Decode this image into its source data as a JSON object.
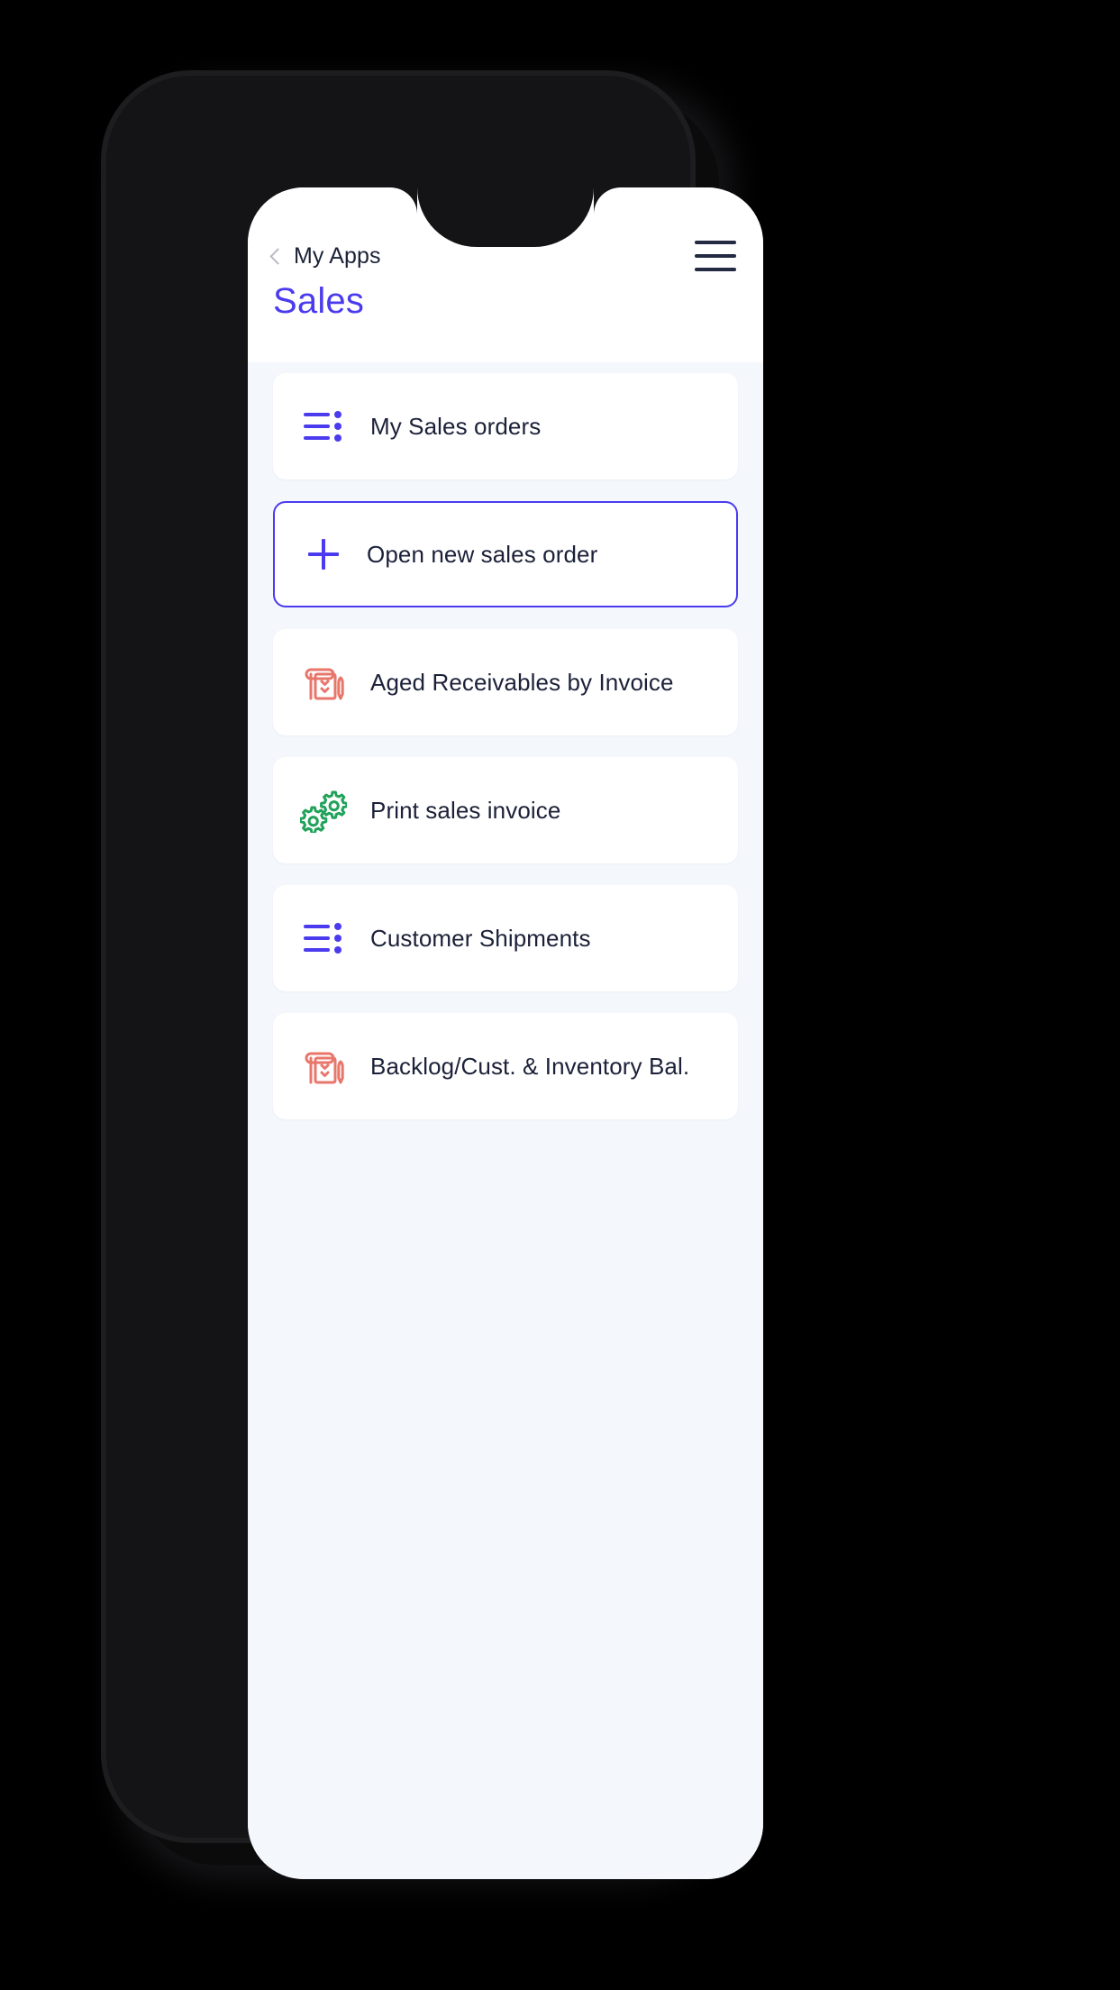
{
  "device": {
    "frame_color": "#141416",
    "screen_bg": "#f4f7fc"
  },
  "header": {
    "back_icon": "chevron-left-icon",
    "back_label": "My Apps",
    "menu_icon": "hamburger-menu-icon",
    "title": "Sales",
    "title_color": "#4b3bee",
    "bar_bg": "#ffffff"
  },
  "list": {
    "items": [
      {
        "label": "My Sales orders",
        "icon": "bullet-list-icon",
        "icon_color": "#4b3bee",
        "selected": false
      },
      {
        "label": "Open new sales order",
        "icon": "plus-icon",
        "icon_color": "#4b3bee",
        "selected": true
      },
      {
        "label": "Aged Receivables by Invoice",
        "icon": "clipboard-pen-icon",
        "icon_color": "#e8766b",
        "selected": false
      },
      {
        "label": "Print sales invoice",
        "icon": "gears-icon",
        "icon_color": "#21a25a",
        "selected": false
      },
      {
        "label": "Customer Shipments",
        "icon": "bullet-list-icon",
        "icon_color": "#4b3bee",
        "selected": false
      },
      {
        "label": "Backlog/Cust. & Inventory Bal.",
        "icon": "clipboard-pen-icon",
        "icon_color": "#e8766b",
        "selected": false
      }
    ]
  }
}
